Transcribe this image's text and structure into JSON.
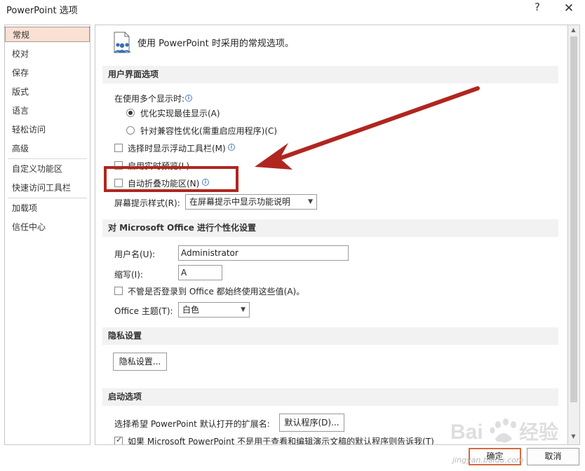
{
  "window": {
    "title": "PowerPoint 选项",
    "help_label": "?",
    "close_label": "✕"
  },
  "sidebar": {
    "items": [
      {
        "label": "常规"
      },
      {
        "label": "校对"
      },
      {
        "label": "保存"
      },
      {
        "label": "版式"
      },
      {
        "label": "语言"
      },
      {
        "label": "轻松访问"
      },
      {
        "label": "高级"
      },
      {
        "label": "自定义功能区"
      },
      {
        "label": "快速访问工具栏"
      },
      {
        "label": "加载项"
      },
      {
        "label": "信任中心"
      }
    ]
  },
  "header": {
    "text": "使用 PowerPoint 时采用的常规选项。"
  },
  "ui_section": {
    "title": "用户界面选项",
    "multi_display_label": "在使用多个显示时:",
    "radio_best": "优化实现最佳显示(A)",
    "radio_compat": "针对兼容性优化(需重启应用程序)(C)",
    "mini_toolbar": "选择时显示浮动工具栏(M)",
    "live_preview": "启用实时预览(L)",
    "auto_collapse": "自动折叠功能区(N)",
    "screentip_label": "屏幕提示样式(R):",
    "screentip_value": "在屏幕提示中显示功能说明"
  },
  "personal_section": {
    "title": "对 Microsoft Office 进行个性化设置",
    "username_label": "用户名(U):",
    "username_value": "Administrator",
    "initials_label": "缩写(I):",
    "initials_value": "A",
    "always_use": "不管是否登录到 Office 都始终使用这些值(A)。",
    "theme_label": "Office 主题(T):",
    "theme_value": "白色"
  },
  "privacy_section": {
    "title": "隐私设置",
    "button": "隐私设置..."
  },
  "startup_section": {
    "title": "启动选项",
    "ext_label": "选择希望 PowerPoint 默认打开的扩展名:",
    "default_programs_button": "默认程序(D)...",
    "notify_default": "如果 Microsoft PowerPoint 不是用于查看和编辑演示文稿的默认程序则告诉我(T)"
  },
  "footer": {
    "ok": "确定",
    "cancel": "取消"
  },
  "watermark": {
    "text": "jingyan.baidu.com"
  },
  "colors": {
    "accent_selected": "#fbe0d4",
    "annotation_red": "#b0261f",
    "ok_border": "#d66a3d"
  }
}
